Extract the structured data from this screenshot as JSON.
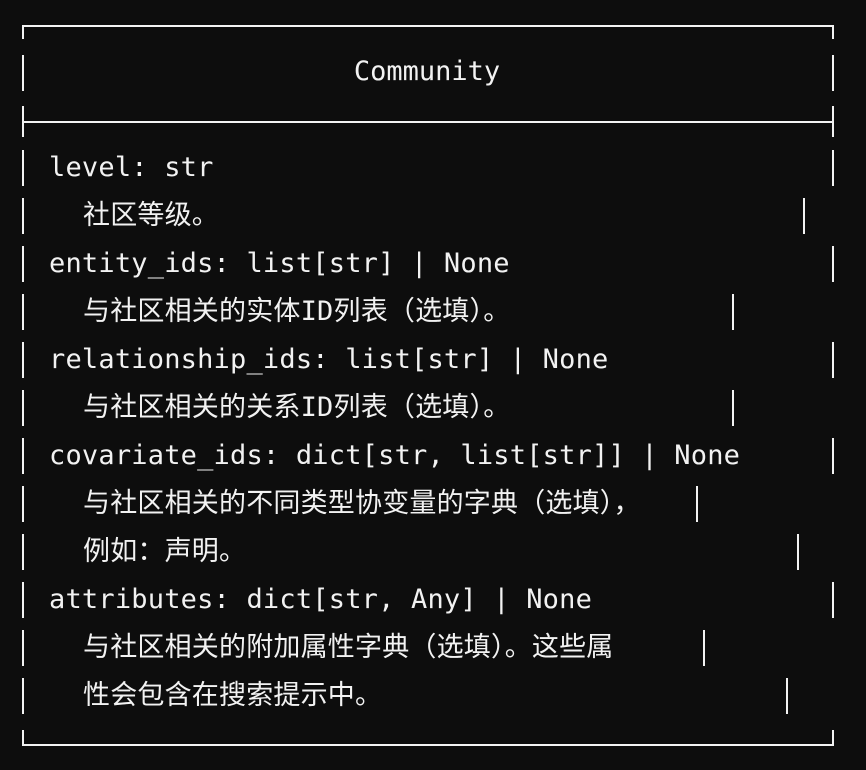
{
  "table": {
    "title": "Community",
    "fields": [
      {
        "signature": "level: str",
        "description": [
          "社区等级。"
        ]
      },
      {
        "signature": "entity_ids: list[str] | None",
        "description": [
          "与社区相关的实体ID列表（选填）。"
        ]
      },
      {
        "signature": "relationship_ids: list[str] | None",
        "description": [
          "与社区相关的关系ID列表（选填）。"
        ]
      },
      {
        "signature": "covariate_ids: dict[str, list[str]] | None",
        "description": [
          "与社区相关的不同类型协变量的字典（选填），",
          "例如：声明。"
        ]
      },
      {
        "signature": "attributes: dict[str, Any] | None",
        "description": [
          "与社区相关的附加属性字典（选填）。这些属",
          "性会包含在搜索提示中。"
        ]
      }
    ]
  }
}
